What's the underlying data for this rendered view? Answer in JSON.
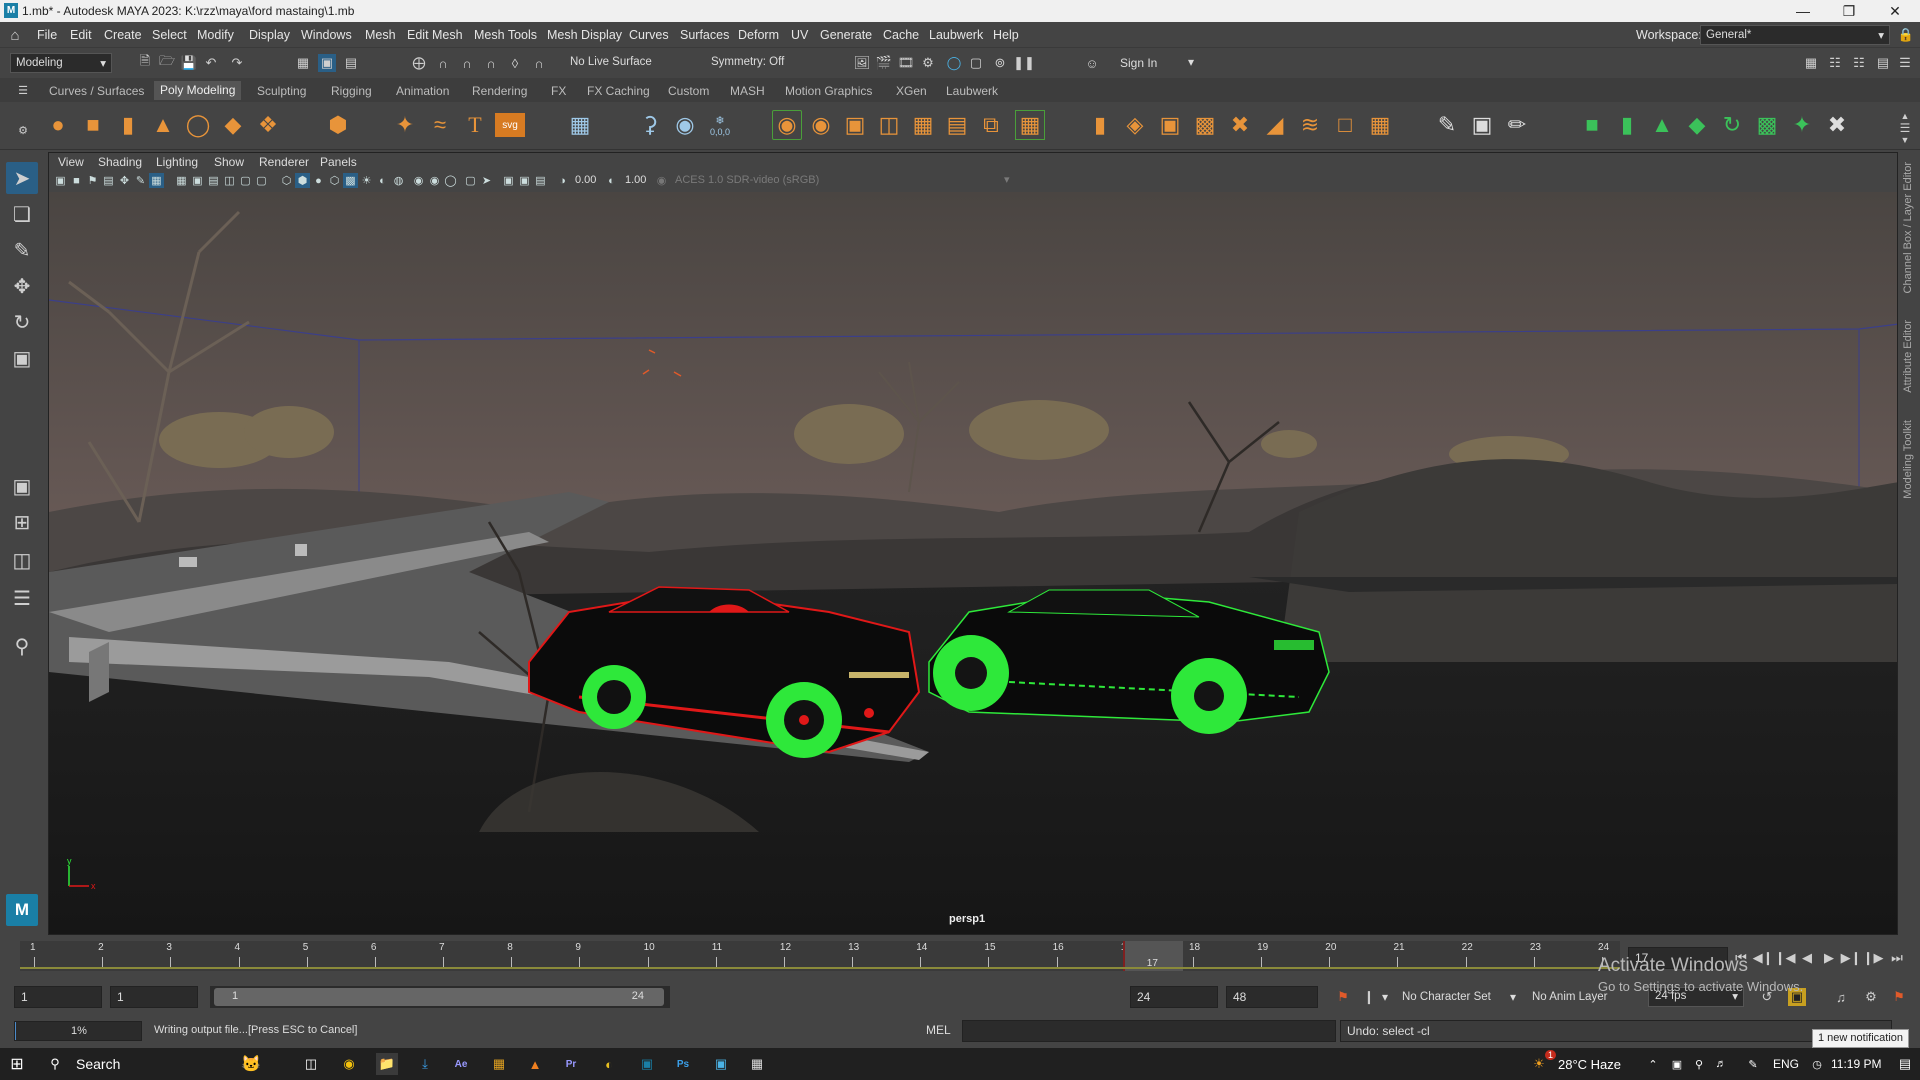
{
  "window": {
    "title": "1.mb* - Autodesk MAYA 2023: K:\\rzz\\maya\\ford mastaing\\1.mb",
    "app_icon_letter": "M"
  },
  "menu": [
    "File",
    "Edit",
    "Create",
    "Select",
    "Modify",
    "Display",
    "Windows",
    "Mesh",
    "Edit Mesh",
    "Mesh Tools",
    "Mesh Display",
    "Curves",
    "Surfaces",
    "Deform",
    "UV",
    "Generate",
    "Cache",
    "Laubwerk",
    "Help"
  ],
  "workspace": {
    "label": "Workspace:",
    "value": "General*"
  },
  "status_line": {
    "mode": "Modeling",
    "live_surface": "No Live Surface",
    "symmetry": "Symmetry: Off",
    "sign_in": "Sign In"
  },
  "shelf_tabs": [
    "Curves / Surfaces",
    "Poly Modeling",
    "Sculpting",
    "Rigging",
    "Animation",
    "Rendering",
    "FX",
    "FX Caching",
    "Custom",
    "MASH",
    "Motion Graphics",
    "XGen",
    "Laubwerk"
  ],
  "shelf_active_tab": "Poly Modeling",
  "shelf_text_icons": {
    "text_tool": "T",
    "svg_tool": "svg",
    "uv_value": "0,0,0"
  },
  "viewport": {
    "menu": [
      "View",
      "Shading",
      "Lighting",
      "Show",
      "Renderer",
      "Panels"
    ],
    "near_value": "0.00",
    "gamma_value": "1.00",
    "color_space": "ACES 1.0 SDR-video (sRGB)",
    "camera_label": "persp1",
    "axis_y": "y",
    "axis_x": "x"
  },
  "right_dock": [
    "Channel Box / Layer Editor",
    "Attribute Editor",
    "Modeling Toolkit"
  ],
  "timeline": {
    "ticks": [
      "1",
      "2",
      "3",
      "4",
      "5",
      "6",
      "7",
      "8",
      "9",
      "10",
      "11",
      "12",
      "13",
      "14",
      "15",
      "16",
      "17",
      "18",
      "19",
      "20",
      "21",
      "22",
      "23",
      "24"
    ],
    "current_frame": "17",
    "current_frame_field": "17",
    "current_frame_value": 17
  },
  "range": {
    "start": "1",
    "anim_start": "1",
    "range_label_start": "1",
    "range_label_end": "24",
    "end": "24",
    "anim_end": "48",
    "character_set": "No Character Set",
    "anim_layer": "No Anim Layer",
    "fps": "24 fps"
  },
  "command": {
    "progress": "1%",
    "progress_value": 0.01,
    "message": "Writing output file...",
    "cancel_hint": "[Press ESC to Cancel]",
    "lang": "MEL",
    "result": "Undo: select -cl"
  },
  "watermark": {
    "line1": "Activate Windows",
    "line2": "Go to Settings to activate Windows."
  },
  "notification": "1 new notification",
  "taskbar": {
    "search": "Search",
    "weather": "28°C Haze",
    "lang": "ENG",
    "time": "11:19 PM",
    "weather_badge": "1"
  },
  "colors": {
    "wheel_green": "#2ee83a",
    "car_red": "#e01818",
    "maya_panel": "#444444",
    "active_icon": "#2a5f86",
    "playhead": "#7f2020"
  }
}
